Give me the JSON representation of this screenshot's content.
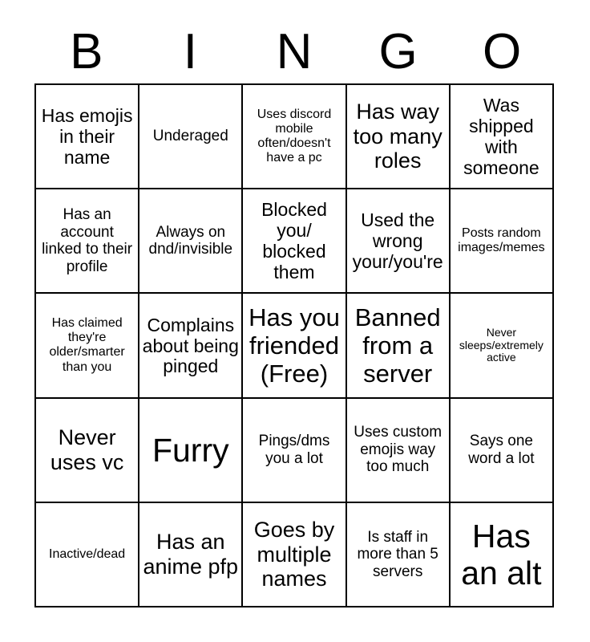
{
  "card": {
    "title_letters": [
      "B",
      "I",
      "N",
      "G",
      "O"
    ],
    "free_space_label": "Has you friended (Free)",
    "grid_size": 5,
    "colors": {
      "background": "#ffffff",
      "text": "#000000",
      "border": "#000000"
    }
  },
  "squares": [
    [
      {
        "text": "Has emojis in their name",
        "size": "lg"
      },
      {
        "text": "Underaged",
        "size": "md"
      },
      {
        "text": "Uses discord mobile often/doesn't have a pc",
        "size": "sm"
      },
      {
        "text": "Has way too many roles",
        "size": "xl"
      },
      {
        "text": "Was shipped with someone",
        "size": "lg"
      }
    ],
    [
      {
        "text": "Has an account linked to their profile",
        "size": "md"
      },
      {
        "text": "Always on dnd/invisible",
        "size": "md"
      },
      {
        "text": "Blocked you/ blocked them",
        "size": "lg"
      },
      {
        "text": "Used the wrong your/you're",
        "size": "lg"
      },
      {
        "text": "Posts random images/memes",
        "size": "sm"
      }
    ],
    [
      {
        "text": "Has claimed they're older/smarter than you",
        "size": "sm"
      },
      {
        "text": "Complains about being pinged",
        "size": "lg"
      },
      {
        "text": "Has you friended (Free)",
        "size": "xxl"
      },
      {
        "text": "Banned from a server",
        "size": "xxl"
      },
      {
        "text": "Never sleeps/extremely active",
        "size": "xs"
      }
    ],
    [
      {
        "text": "Never uses vc",
        "size": "xl"
      },
      {
        "text": "Furry",
        "size": "huge"
      },
      {
        "text": "Pings/dms you a lot",
        "size": "md"
      },
      {
        "text": "Uses custom emojis way too much",
        "size": "md"
      },
      {
        "text": "Says one word a lot",
        "size": "md"
      }
    ],
    [
      {
        "text": "Inactive/dead",
        "size": "sm"
      },
      {
        "text": "Has an anime pfp",
        "size": "xl"
      },
      {
        "text": "Goes by multiple names",
        "size": "xl"
      },
      {
        "text": "Is staff in more than 5 servers",
        "size": "md"
      },
      {
        "text": "Has an alt",
        "size": "huge"
      }
    ]
  ]
}
